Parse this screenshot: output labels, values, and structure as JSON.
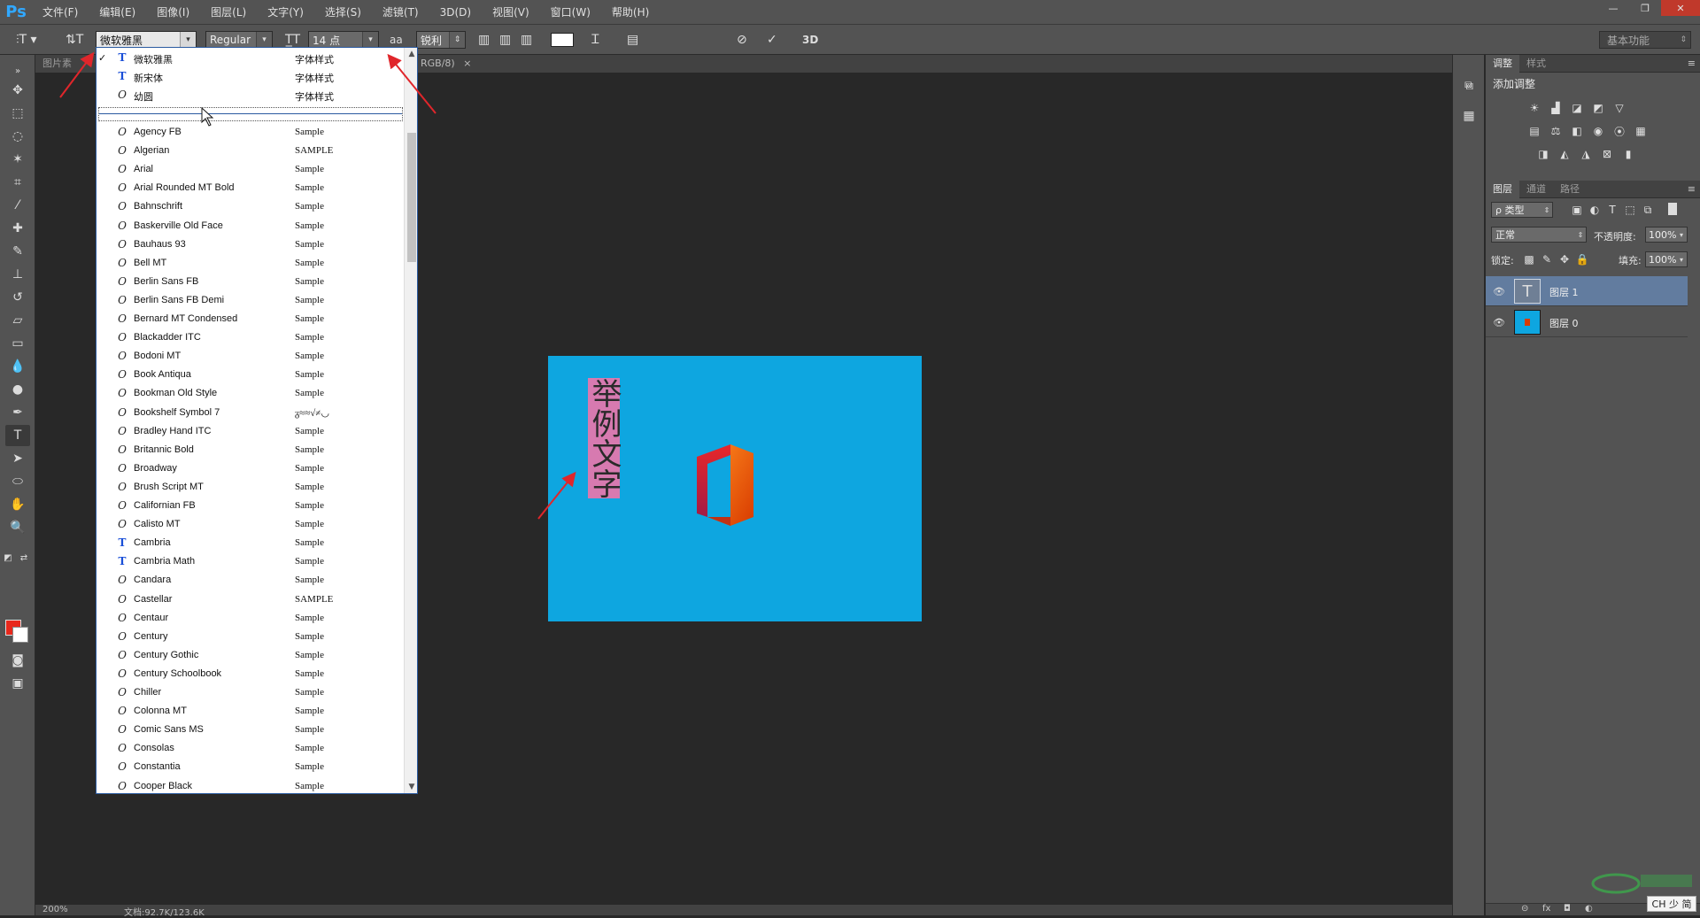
{
  "app": {
    "logo": "Ps",
    "menus": [
      "文件(F)",
      "编辑(E)",
      "图像(I)",
      "图层(L)",
      "文字(Y)",
      "选择(S)",
      "滤镜(T)",
      "3D(D)",
      "视图(V)",
      "窗口(W)",
      "帮助(H)"
    ],
    "window_controls": [
      "—",
      "❐",
      "✕"
    ]
  },
  "options_bar": {
    "font_family": "微软雅黑",
    "font_style": "Regular",
    "font_size": "14 点",
    "anti_alias_icon": "aa",
    "anti_alias": "锐利",
    "workspace": "基本功能",
    "three_d_label": "3D",
    "text_color": "#ffffff"
  },
  "doc_tabs": {
    "left_tab": "图片素",
    "right_tab": "RGB/8)",
    "close_glyph": "×"
  },
  "canvas": {
    "background": "#0ea6e0",
    "vertical_text": "举例文字",
    "text_highlight": "#d77ab0"
  },
  "status_bar": {
    "zoom": "200%",
    "doc_info": "文档:92.7K/123.6K"
  },
  "font_list": {
    "recent": [
      {
        "name": "微软雅黑",
        "sample": "字体样式",
        "type": "tt",
        "checked": true
      },
      {
        "name": "新宋体",
        "sample": "字体样式",
        "type": "tt",
        "checked": false
      },
      {
        "name": "幼圆",
        "sample": "字体样式",
        "type": "ot",
        "checked": false
      }
    ],
    "fonts": [
      {
        "name": "Agency FB",
        "sample": "Sample",
        "type": "ot"
      },
      {
        "name": "Algerian",
        "sample": "SAMPLE",
        "type": "ot"
      },
      {
        "name": "Arial",
        "sample": "Sample",
        "type": "ot"
      },
      {
        "name": "Arial Rounded MT Bold",
        "sample": "Sample",
        "type": "ot"
      },
      {
        "name": "Bahnschrift",
        "sample": "Sample",
        "type": "ot"
      },
      {
        "name": "Baskerville Old Face",
        "sample": "Sample",
        "type": "ot"
      },
      {
        "name": "Bauhaus 93",
        "sample": "Sample",
        "type": "ot"
      },
      {
        "name": "Bell MT",
        "sample": "Sample",
        "type": "ot"
      },
      {
        "name": "Berlin Sans FB",
        "sample": "Sample",
        "type": "ot"
      },
      {
        "name": "Berlin Sans FB Demi",
        "sample": "Sample",
        "type": "ot"
      },
      {
        "name": "Bernard MT Condensed",
        "sample": "Sample",
        "type": "ot"
      },
      {
        "name": "Blackadder ITC",
        "sample": "Sample",
        "type": "ot"
      },
      {
        "name": "Bodoni MT",
        "sample": "Sample",
        "type": "ot"
      },
      {
        "name": "Book Antiqua",
        "sample": "Sample",
        "type": "ot"
      },
      {
        "name": "Bookman Old Style",
        "sample": "Sample",
        "type": "ot"
      },
      {
        "name": "Bookshelf Symbol 7",
        "sample": "ᵹ≈≈√≠◡",
        "type": "ot"
      },
      {
        "name": "Bradley Hand ITC",
        "sample": "Sample",
        "type": "ot"
      },
      {
        "name": "Britannic Bold",
        "sample": "Sample",
        "type": "ot"
      },
      {
        "name": "Broadway",
        "sample": "Sample",
        "type": "ot"
      },
      {
        "name": "Brush Script MT",
        "sample": "Sample",
        "type": "ot"
      },
      {
        "name": "Californian FB",
        "sample": "Sample",
        "type": "ot"
      },
      {
        "name": "Calisto MT",
        "sample": "Sample",
        "type": "ot"
      },
      {
        "name": "Cambria",
        "sample": "Sample",
        "type": "tt"
      },
      {
        "name": "Cambria Math",
        "sample": "Sample",
        "type": "tt"
      },
      {
        "name": "Candara",
        "sample": "Sample",
        "type": "ot"
      },
      {
        "name": "Castellar",
        "sample": "SAMPLE",
        "type": "ot"
      },
      {
        "name": "Centaur",
        "sample": "Sample",
        "type": "ot"
      },
      {
        "name": "Century",
        "sample": "Sample",
        "type": "ot"
      },
      {
        "name": "Century Gothic",
        "sample": "Sample",
        "type": "ot"
      },
      {
        "name": "Century Schoolbook",
        "sample": "Sample",
        "type": "ot"
      },
      {
        "name": "Chiller",
        "sample": "Sample",
        "type": "ot"
      },
      {
        "name": "Colonna MT",
        "sample": "Sample",
        "type": "ot"
      },
      {
        "name": "Comic Sans MS",
        "sample": "Sample",
        "type": "ot"
      },
      {
        "name": "Consolas",
        "sample": "Sample",
        "type": "ot"
      },
      {
        "name": "Constantia",
        "sample": "Sample",
        "type": "ot"
      },
      {
        "name": "Cooper Black",
        "sample": "Sample",
        "type": "ot"
      }
    ]
  },
  "adjustments_panel": {
    "tabs": [
      "调整",
      "样式"
    ],
    "title": "添加调整"
  },
  "layers_panel": {
    "tabs": [
      "图层",
      "通道",
      "路径"
    ],
    "filter_label": "ρ 类型",
    "blend_mode": "正常",
    "opacity_label": "不透明度:",
    "opacity_value": "100%",
    "lock_label": "锁定:",
    "fill_label": "填充:",
    "fill_value": "100%",
    "layers": [
      {
        "name": "图层 1",
        "kind": "text",
        "selected": true,
        "thumb_glyph": "T"
      },
      {
        "name": "图层 0",
        "kind": "image",
        "selected": false
      }
    ]
  },
  "overlay": {
    "ime_indicator": "CH 少 简"
  }
}
